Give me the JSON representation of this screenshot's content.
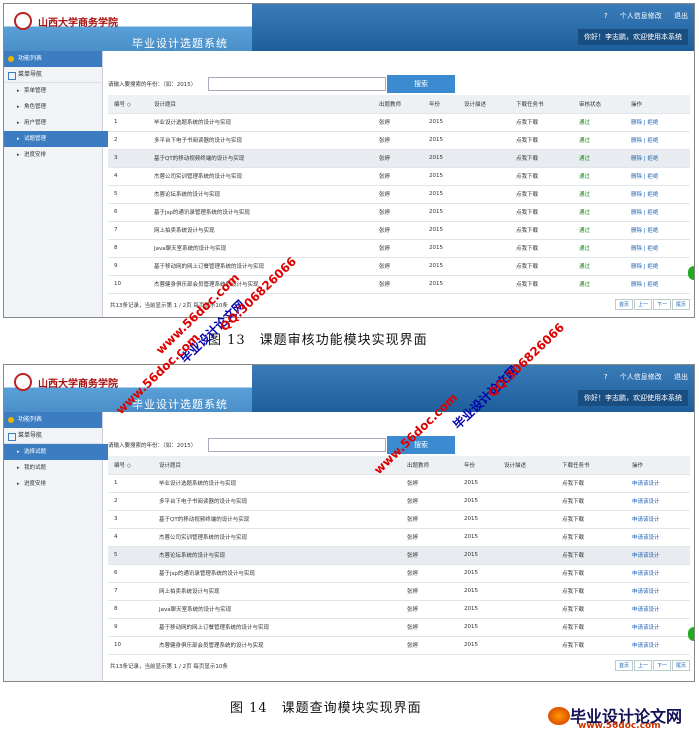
{
  "school_name": "山西大学商务学院",
  "system_title": "毕业设计选题系统",
  "user_links": {
    "help": "?",
    "profile": "个人信息修改",
    "logout": "退出"
  },
  "welcome": "你好！李志鹏，欢迎使用本系统",
  "sidebar": {
    "title": "功能列表",
    "menu_head": "菜单导航"
  },
  "fig1": {
    "menu_items": [
      "菜单管理",
      "角色管理",
      "用户管理",
      "试题管理",
      "进度安排"
    ],
    "active": 3,
    "search_label": "请输入要搜索的年份：（如：2015）",
    "search_button": "搜索",
    "headers": [
      "编号 ◇",
      "设计题目",
      "出题教师",
      "年份",
      "设计描述",
      "下载任务书",
      "审核状态",
      "操作"
    ],
    "highlight_row": 2,
    "summary": "共13条记录，当前显示第 1 / 2页 每页显示10条",
    "caption": "图 13　课题审核功能模块实现界面"
  },
  "fig2": {
    "menu_items": [
      "选择试题",
      "我的试题",
      "进度安排"
    ],
    "active": 0,
    "search_label": "请输入要搜索的年份：（如：2015）",
    "search_button": "搜索",
    "headers": [
      "编号 ◇",
      "设计题目",
      "出题教师",
      "年份",
      "设计描述",
      "下载任务书",
      "操作"
    ],
    "highlight_row": 4,
    "summary": "共13条记录，当前显示第 1 / 2页 每页显示10条",
    "caption": "图 14　课题查询模块实现界面"
  },
  "rows": [
    {
      "id": "1",
      "title": "毕业设计选题系统的设计与实现",
      "teacher": "张婷",
      "year": "2015",
      "desc": "",
      "download": "点我下载"
    },
    {
      "id": "2",
      "title": "多平台下电子书阅读器的设计与实现",
      "teacher": "张婷",
      "year": "2015",
      "desc": "",
      "download": "点我下载"
    },
    {
      "id": "3",
      "title": "基于QT的移动视频终端的设计与实现",
      "teacher": "张婷",
      "year": "2015",
      "desc": "",
      "download": "点我下载"
    },
    {
      "id": "4",
      "title": "杰蓉公司实训管理系统的设计与实现",
      "teacher": "张婷",
      "year": "2015",
      "desc": "",
      "download": "点我下载"
    },
    {
      "id": "5",
      "title": "杰蓉论坛系统的设计与实现",
      "teacher": "张婷",
      "year": "2015",
      "desc": "",
      "download": "点我下载"
    },
    {
      "id": "6",
      "title": "基于jsp的通讯录管理系统的设计与实现",
      "teacher": "张婷",
      "year": "2015",
      "desc": "",
      "download": "点我下载"
    },
    {
      "id": "7",
      "title": "网上拍卖系统设计与实现",
      "teacher": "张婷",
      "year": "2015",
      "desc": "",
      "download": "点我下载"
    },
    {
      "id": "8",
      "title": "Java聊天室系统的设计与实现",
      "teacher": "张婷",
      "year": "2015",
      "desc": "",
      "download": "点我下载"
    },
    {
      "id": "9",
      "title": "基于移动网的网上订餐管理系统的设计与实现",
      "teacher": "张婷",
      "year": "2015",
      "desc": "",
      "download": "点我下载"
    },
    {
      "id": "10",
      "title": "杰蓉健身俱乐部会员管理系统的设计与实现",
      "teacher": "张婷",
      "year": "2015",
      "desc": "",
      "download": "点我下载"
    }
  ],
  "status_pass": "通过",
  "op_audit": "删除 | 拒绝",
  "op_apply": "申请该设计",
  "pager": [
    "首页",
    "上一",
    "下一",
    "尾页"
  ],
  "watermarks": {
    "site": "www.56doc.com",
    "qq": "QQ:306826066",
    "brand": "毕业设计论文网"
  },
  "footer_brand": {
    "name": "毕业设计论文网",
    "url": "www.56doc.com"
  }
}
